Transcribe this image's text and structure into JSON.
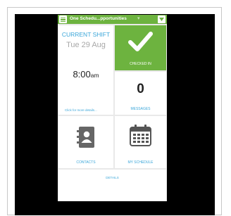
{
  "header": {
    "title": "One Schedu...pportunities",
    "menu_icon": "hamburger-menu-icon",
    "dropdown_icon": "chevron-down-icon"
  },
  "tiles": {
    "current_shift": {
      "label": "CURRENT SHIFT",
      "date": "Tue 29 Aug",
      "time": "8:00",
      "ampm": "am",
      "more_link": "Click for more details..."
    },
    "checked_in": {
      "label": "CHECKED IN",
      "icon": "checkmark-icon"
    },
    "messages": {
      "count": "0",
      "label": "MESSAGES"
    },
    "contacts": {
      "label": "CONTACTS",
      "icon": "contacts-book-icon"
    },
    "my_schedule": {
      "label": "MY SCHEDULE",
      "icon": "calendar-icon"
    },
    "details": {
      "label": "DETAILS"
    }
  },
  "colors": {
    "accent_green": "#6db33f",
    "link_blue": "#3aa6d9",
    "background_black": "#000000",
    "tile_bg": "#ffffff"
  }
}
